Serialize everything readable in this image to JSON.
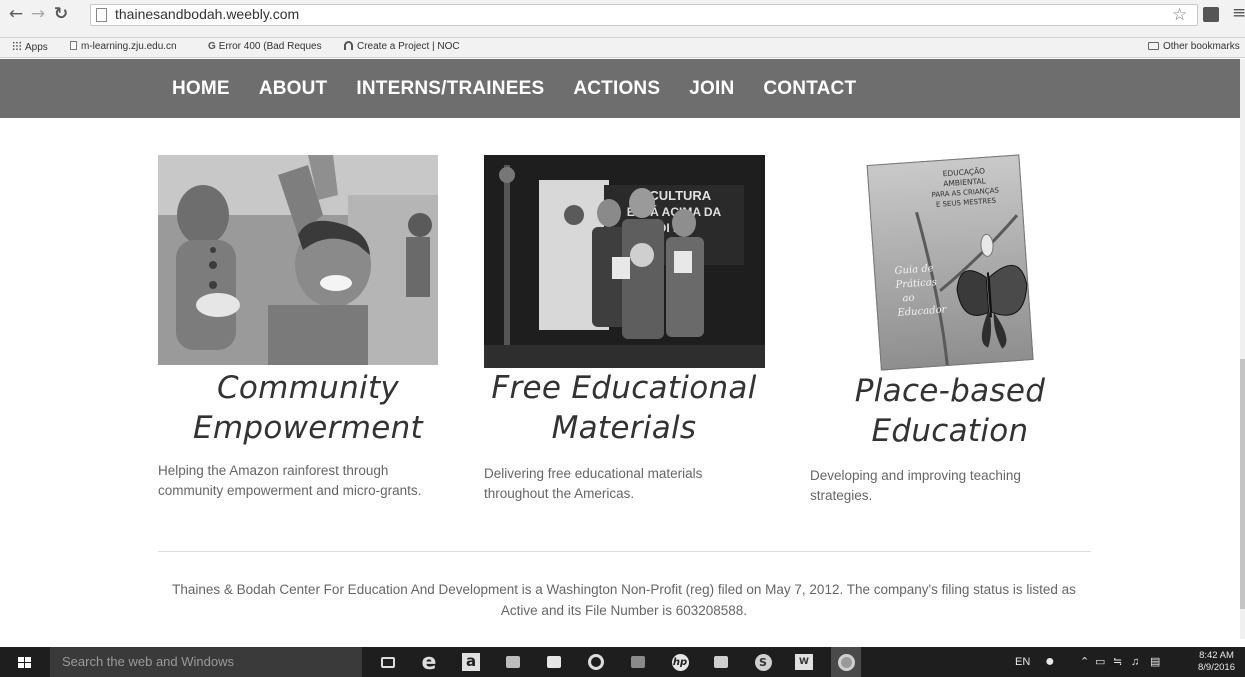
{
  "browser": {
    "url": "thainesandbodah.weebly.com",
    "bookmarks": [
      {
        "label": "Apps"
      },
      {
        "label": "m-learning.zju.edu.cn"
      },
      {
        "label": "Error 400 (Bad Reques"
      },
      {
        "label": "Create a Project | NOC"
      }
    ],
    "other_bookmarks": "Other bookmarks"
  },
  "site_nav": {
    "items": [
      "HOME",
      "ABOUT",
      "INTERNS/TRAINEES",
      "ACTIONS",
      "JOIN",
      "CONTACT"
    ]
  },
  "columns": [
    {
      "title_line1": "Community",
      "title_line2": "Empowerment",
      "text": "Helping the Amazon rainforest through community empowerment and micro-grants."
    },
    {
      "title_line1": "Free Educational",
      "title_line2": "Materials",
      "text": "Delivering free educational materials throughout the Americas.",
      "banner_text_1": "A CULTURA",
      "banner_text_2": "ESTÁ ACIMA DA",
      "banner_text_3": "DI      DA"
    },
    {
      "title_line1": "Place-based",
      "title_line2": "Education",
      "text": "Developing and improving teaching strategies.",
      "book_title_1": "EDUCAÇÃO",
      "book_title_2": "AMBIENTAL",
      "book_title_3": "PARA AS CRIANÇAS",
      "book_title_4": "E SEUS MESTRES",
      "book_subtitle_1": "Guia de",
      "book_subtitle_2": "Práticas",
      "book_subtitle_3": "ao",
      "book_subtitle_4": "Educador"
    }
  ],
  "footer": {
    "text": "Thaines & Bodah Center For Education And Development is a Washington Non-Profit (reg) filed on May 7, 2012. The company's filing status is listed as Active and its File Number is 603208588."
  },
  "taskbar": {
    "search_placeholder": "Search the web and Windows",
    "language": "EN",
    "time": "8:42 AM",
    "date": "8/9/2016"
  }
}
